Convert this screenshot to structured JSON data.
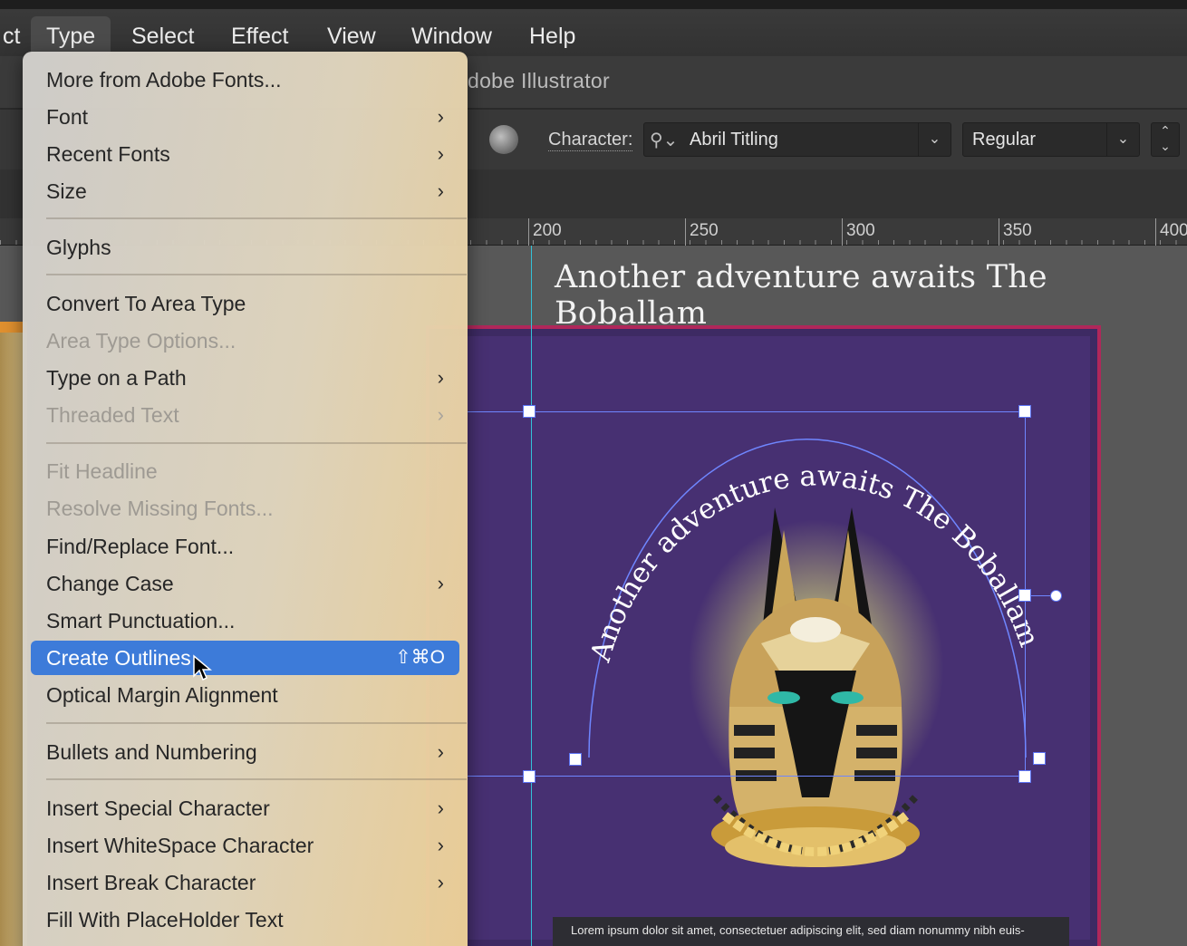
{
  "menubar": {
    "items": [
      "ct",
      "Type",
      "Select",
      "Effect",
      "View",
      "Window",
      "Help"
    ],
    "active": "Type"
  },
  "window": {
    "title": "dobe Illustrator"
  },
  "controlbar": {
    "character_label": "Character:",
    "font_name": "Abril Titling",
    "font_style": "Regular"
  },
  "ruler": {
    "labels": [
      "200",
      "250",
      "300",
      "350",
      "400"
    ]
  },
  "canvas": {
    "headline": "Another adventure awaits The Boballam",
    "arc_text": "Another adventure awaits The Boballam",
    "footer_text": "Lorem ipsum dolor sit amet, consectetuer adipiscing elit, sed diam nonummy nibh euis-"
  },
  "type_menu": {
    "items": [
      {
        "label": "More from Adobe Fonts...",
        "submenu": false,
        "disabled": false
      },
      {
        "label": "Font",
        "submenu": true,
        "disabled": false
      },
      {
        "label": "Recent Fonts",
        "submenu": true,
        "disabled": false
      },
      {
        "label": "Size",
        "submenu": true,
        "disabled": false
      },
      {
        "label": "Glyphs",
        "submenu": false,
        "disabled": false
      },
      {
        "label": "Convert To Area Type",
        "submenu": false,
        "disabled": false
      },
      {
        "label": "Area Type Options...",
        "submenu": false,
        "disabled": true
      },
      {
        "label": "Type on a Path",
        "submenu": true,
        "disabled": false
      },
      {
        "label": "Threaded Text",
        "submenu": true,
        "disabled": true
      },
      {
        "label": "Fit Headline",
        "submenu": false,
        "disabled": true
      },
      {
        "label": "Resolve Missing Fonts...",
        "submenu": false,
        "disabled": true
      },
      {
        "label": "Find/Replace Font...",
        "submenu": false,
        "disabled": false
      },
      {
        "label": "Change Case",
        "submenu": true,
        "disabled": false
      },
      {
        "label": "Smart Punctuation...",
        "submenu": false,
        "disabled": false
      },
      {
        "label": "Create Outlines",
        "submenu": false,
        "disabled": false,
        "shortcut": "⇧⌘O",
        "highlighted": true
      },
      {
        "label": "Optical Margin Alignment",
        "submenu": false,
        "disabled": false
      },
      {
        "label": "Bullets and Numbering",
        "submenu": true,
        "disabled": false
      },
      {
        "label": "Insert Special Character",
        "submenu": true,
        "disabled": false
      },
      {
        "label": "Insert WhiteSpace Character",
        "submenu": true,
        "disabled": false
      },
      {
        "label": "Insert Break Character",
        "submenu": true,
        "disabled": false
      },
      {
        "label": "Fill With PlaceHolder Text",
        "submenu": false,
        "disabled": false
      }
    ]
  },
  "colors": {
    "menu_highlight": "#3d7bd9",
    "artboard": "#473072",
    "guide": "#33c2d8",
    "selection": "#6f86ff"
  }
}
